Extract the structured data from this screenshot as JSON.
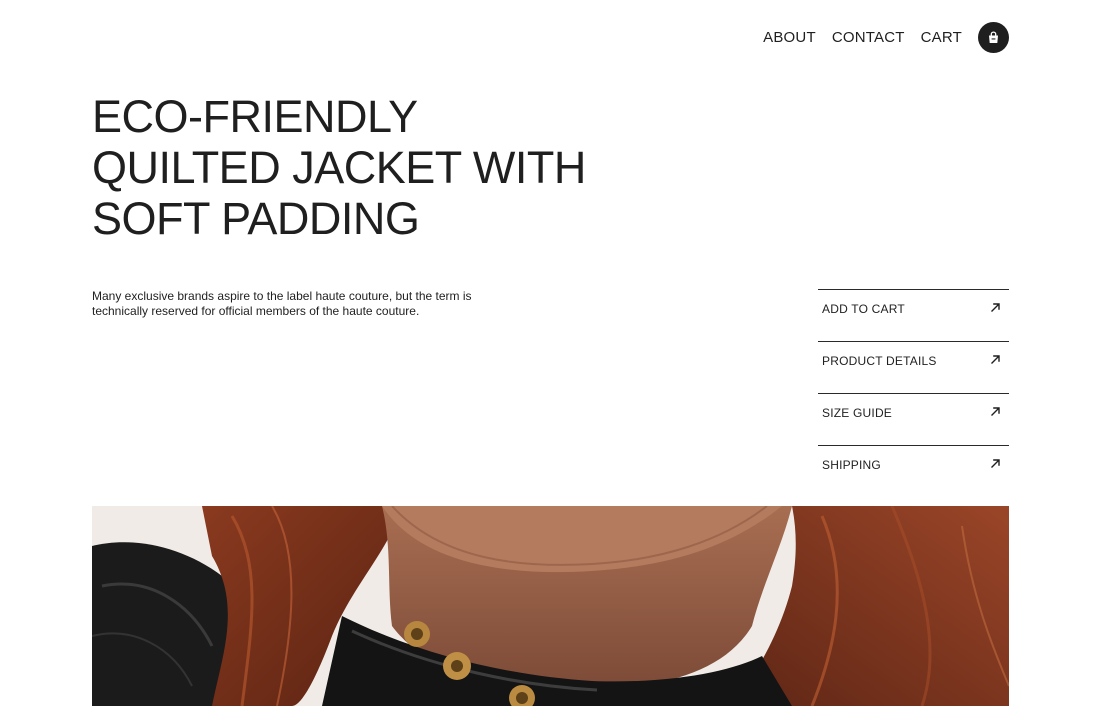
{
  "nav": {
    "links": [
      "ABOUT",
      "CONTACT",
      "CART"
    ],
    "cart_icon": "shopping-bag-icon"
  },
  "product": {
    "title_lines": [
      "ECO-FRIENDLY",
      "QUILTED JACKET WITH",
      "SOFT PADDING"
    ],
    "description": "Many exclusive brands aspire to the label haute couture, but the term is technically reserved for official members of the haute couture."
  },
  "actions": [
    {
      "label": "ADD TO CART",
      "icon": "arrow-up-right-icon"
    },
    {
      "label": "PRODUCT DETAILS",
      "icon": "arrow-up-right-icon"
    },
    {
      "label": "SIZE GUIDE",
      "icon": "arrow-up-right-icon"
    },
    {
      "label": "SHIPPING",
      "icon": "arrow-up-right-icon"
    }
  ],
  "colors": {
    "text": "#1f1f1f",
    "background": "#ffffff",
    "accent": "#1f1f1f"
  }
}
